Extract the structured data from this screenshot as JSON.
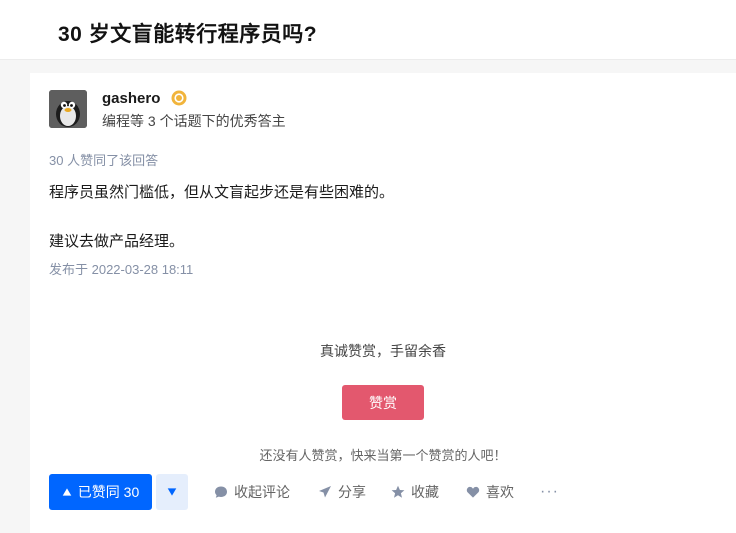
{
  "question": {
    "title": "30 岁文盲能转行程序员吗?"
  },
  "author": {
    "name": "gashero",
    "description": "编程等 3 个话题下的优秀答主",
    "avatar_icon": "penguin-avatar",
    "badge_icon": "excellent-answerer-badge-icon"
  },
  "answer": {
    "voters": "30 人赞同了该回答",
    "paragraphs": [
      "程序员虽然门槛低，但从文盲起步还是有些困难的。",
      "建议去做产品经理。"
    ],
    "published": "发布于 2022-03-28 18:11"
  },
  "reward": {
    "prompt": "真诚赞赏，手留余香",
    "button_label": "赞赏",
    "empty_text": "还没有人赞赏，快来当第一个赞赏的人吧！"
  },
  "actions": {
    "upvote_label": "已赞同 30",
    "collapse_comments_label": "收起评论",
    "share_label": "分享",
    "favorite_label": "收藏",
    "like_label": "喜欢",
    "more_label": "···"
  },
  "colors": {
    "primary": "#0066ff",
    "reward": "#e3586e",
    "meta": "#8590a6"
  }
}
